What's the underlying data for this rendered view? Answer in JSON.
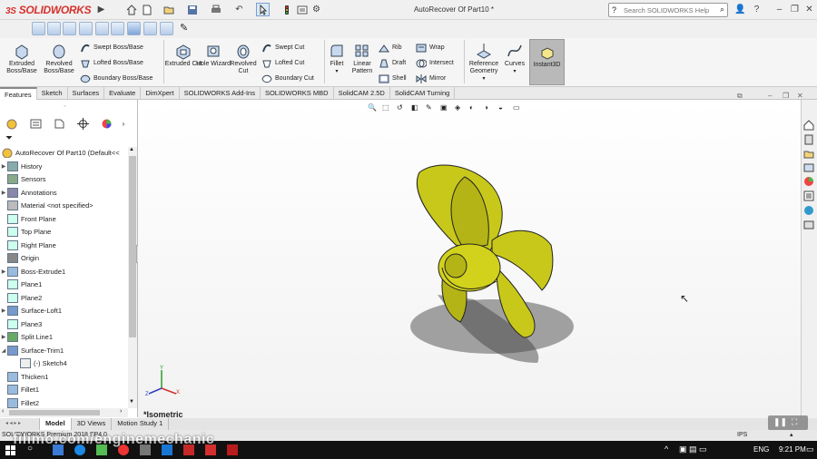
{
  "app": {
    "brand": "SOLIDWORKS",
    "brand_prefix": "3S",
    "title": "AutoRecover Of Part10 *"
  },
  "search": {
    "placeholder": "Search SOLIDWORKS Help"
  },
  "ribbon": {
    "extruded_boss": "Extruded Boss/Base",
    "revolved_boss": "Revolved Boss/Base",
    "swept_boss": "Swept Boss/Base",
    "lofted_boss": "Lofted Boss/Base",
    "boundary_boss": "Boundary Boss/Base",
    "extruded_cut": "Extruded Cut",
    "hole_wizard": "Hole Wizard",
    "revolved_cut": "Revolved Cut",
    "swept_cut": "Swept Cut",
    "lofted_cut": "Lofted Cut",
    "boundary_cut": "Boundary Cut",
    "fillet": "Fillet",
    "linear_pattern": "Linear Pattern",
    "rib": "Rib",
    "draft": "Draft",
    "shell": "Shell",
    "wrap": "Wrap",
    "intersect": "Intersect",
    "mirror": "Mirror",
    "reference_geometry": "Reference Geometry",
    "curves": "Curves",
    "instant3d": "Instant3D"
  },
  "tabs": [
    "Features",
    "Sketch",
    "Surfaces",
    "Evaluate",
    "DimXpert",
    "SOLIDWORKS Add-Ins",
    "SOLIDWORKS MBD",
    "SolidCAM 2.5D",
    "SolidCAM Turning"
  ],
  "tree": {
    "root": "AutoRecover Of Part10  (Default<<",
    "items": [
      {
        "label": "History",
        "icon": "history-icon",
        "exp": true
      },
      {
        "label": "Sensors",
        "icon": "sensors-icon",
        "exp": false
      },
      {
        "label": "Annotations",
        "icon": "annotations-icon",
        "exp": true
      },
      {
        "label": "Material <not specified>",
        "icon": "material-icon",
        "exp": false
      },
      {
        "label": "Front Plane",
        "icon": "plane-icon",
        "exp": false
      },
      {
        "label": "Top Plane",
        "icon": "plane-icon",
        "exp": false
      },
      {
        "label": "Right Plane",
        "icon": "plane-icon",
        "exp": false
      },
      {
        "label": "Origin",
        "icon": "origin-icon",
        "exp": false
      },
      {
        "label": "Boss-Extrude1",
        "icon": "extrude-icon",
        "exp": true
      },
      {
        "label": "Plane1",
        "icon": "plane-icon",
        "exp": false
      },
      {
        "label": "Plane2",
        "icon": "plane-icon",
        "exp": false
      },
      {
        "label": "Surface-Loft1",
        "icon": "surface-loft-icon",
        "exp": true
      },
      {
        "label": "Plane3",
        "icon": "plane-icon",
        "exp": false
      },
      {
        "label": "Split Line1",
        "icon": "split-line-icon",
        "exp": true
      },
      {
        "label": "Surface-Trim1",
        "icon": "surface-trim-icon",
        "exp": "open"
      },
      {
        "label": "(-) Sketch4",
        "icon": "sketch-icon",
        "exp": false,
        "child": true
      },
      {
        "label": "Thicken1",
        "icon": "thicken-icon",
        "exp": false
      },
      {
        "label": "Fillet1",
        "icon": "fillet-icon",
        "exp": false
      },
      {
        "label": "Fillet2",
        "icon": "fillet-icon",
        "exp": false
      }
    ]
  },
  "bottom_tabs": [
    "Model",
    "3D Views",
    "Motion Study 1"
  ],
  "view_label": "*Isometric",
  "status": {
    "left": "SOLIDWORKS Premium 2018 SP4.0",
    "units": "IPS"
  },
  "watermark": "filimo.com/enginemechanic",
  "taskbar": {
    "lang": "ENG",
    "time": "9:21 PM"
  },
  "colors": {
    "accent": "#d6322c",
    "part": "#c8c81a"
  }
}
